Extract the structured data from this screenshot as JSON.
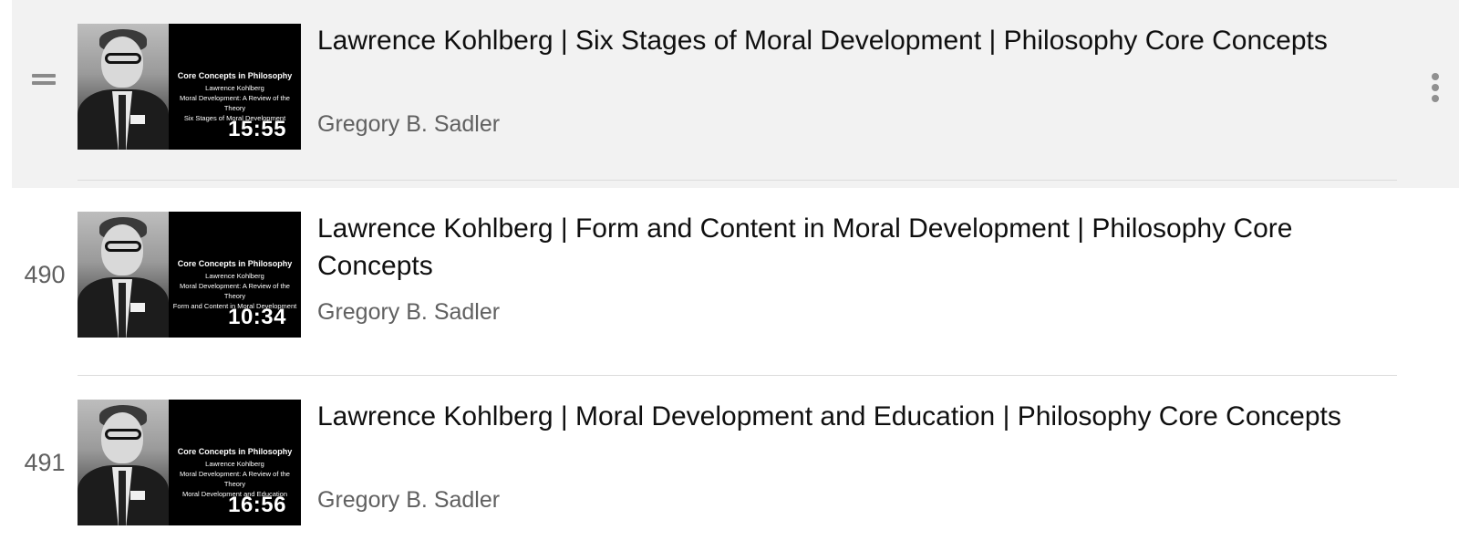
{
  "playlist": {
    "items": [
      {
        "index": "",
        "title": "Lawrence Kohlberg | Six Stages of Moral Development | Philosophy Core Concepts",
        "channel": "Gregory B. Sadler",
        "duration": "15:55",
        "thumb": {
          "line1": "Core Concepts in Philosophy",
          "line2": "Lawrence Kohlberg",
          "line3": "Moral Development: A Review of the Theory",
          "line4": "Six Stages of Moral Development"
        },
        "hovered": true,
        "handle_icon": "drag-handle-icon",
        "menu_icon": "more-vertical-icon"
      },
      {
        "index": "490",
        "title": "Lawrence Kohlberg | Form and Content in Moral Development | Philosophy Core Concepts",
        "channel": "Gregory B. Sadler",
        "duration": "10:34",
        "thumb": {
          "line1": "Core Concepts in Philosophy",
          "line2": "Lawrence Kohlberg",
          "line3": "Moral Development: A Review of the Theory",
          "line4": "Form and Content in Moral Development"
        },
        "hovered": false
      },
      {
        "index": "491",
        "title": "Lawrence Kohlberg | Moral Development and Education | Philosophy Core Concepts",
        "channel": "Gregory B. Sadler",
        "duration": "16:56",
        "thumb": {
          "line1": "Core Concepts in Philosophy",
          "line2": "Lawrence Kohlberg",
          "line3": "Moral Development: A Review of the Theory",
          "line4": "Moral Development and Education"
        },
        "hovered": false
      }
    ]
  },
  "colors": {
    "hover_bg": "#f2f2f2",
    "title": "#0f0f0f",
    "secondary": "#606060",
    "divider": "#dcdcdc"
  }
}
